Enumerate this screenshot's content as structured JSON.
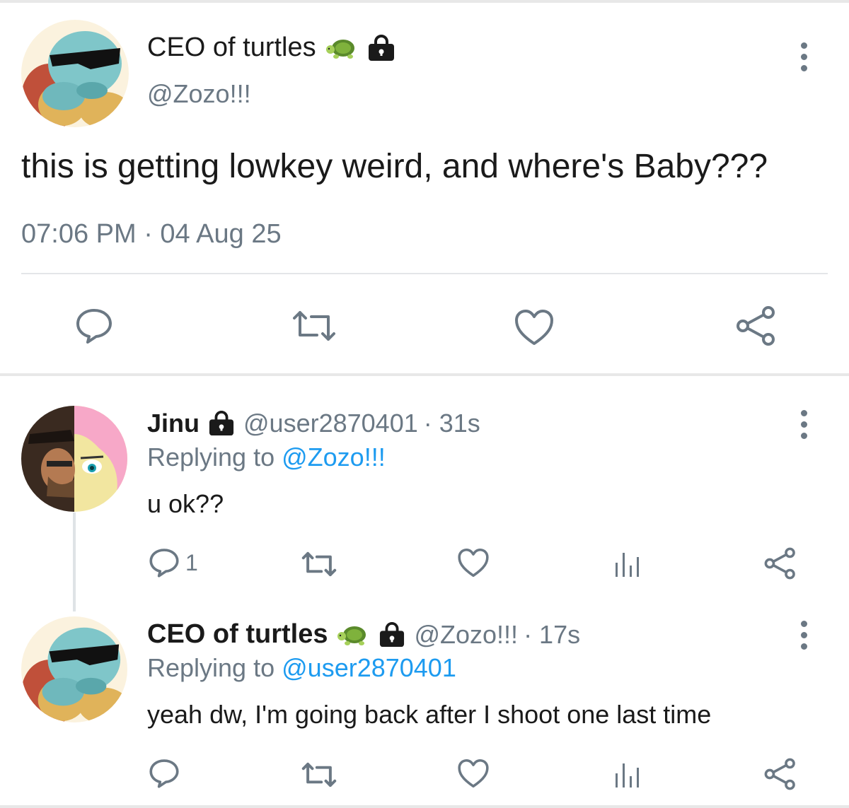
{
  "main_tweet": {
    "name": "CEO of turtles",
    "handle": "@Zozo!!!",
    "text": "this is getting lowkey weird, and where's Baby???",
    "timestamp": "07:06 PM · 04 Aug 25",
    "name_icons": [
      "turtle-icon",
      "lock-icon"
    ],
    "actions": [
      "reply-icon",
      "retweet-icon",
      "like-icon",
      "share-icon"
    ]
  },
  "replies": [
    {
      "name": "Jinu",
      "handle": "@user2870401",
      "time": "· 31s",
      "replying_label": "Replying to",
      "replying_to": "@Zozo!!!",
      "text": "u ok??",
      "reply_count": "1",
      "name_icons": [
        "lock-icon"
      ]
    },
    {
      "name": "CEO of turtles",
      "handle": "@Zozo!!!",
      "time": "· 17s",
      "replying_label": "Replying to",
      "replying_to": "@user2870401",
      "text": "yeah dw, I'm going back after I shoot one last time",
      "reply_count": "",
      "name_icons": [
        "turtle-icon",
        "lock-icon"
      ]
    }
  ],
  "colors": {
    "text": "#1a1a1a",
    "muted": "#6b7884",
    "link": "#1d9bf0",
    "divider": "#e4e6e8"
  }
}
